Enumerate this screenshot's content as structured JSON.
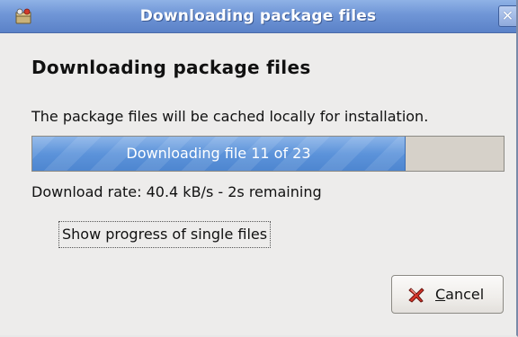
{
  "window": {
    "title": "Downloading package files",
    "close_glyph": "✕",
    "app_icon": "package-manager-icon"
  },
  "dialog": {
    "heading": "Downloading package files",
    "description": "The package files will be cached locally for installation.",
    "progress": {
      "label": "Downloading file 11 of 23",
      "fraction": 0.79,
      "fill_color": "#5c93da"
    },
    "rate_text": "Download rate: 40.4 kB/s - 2s remaining",
    "expander": {
      "label": "Show progress of single files",
      "expanded": false,
      "icon": "triangle-right-icon"
    },
    "cancel_button": {
      "mnemonic": "C",
      "label_rest": "ancel",
      "icon": "cancel-x-icon"
    }
  }
}
